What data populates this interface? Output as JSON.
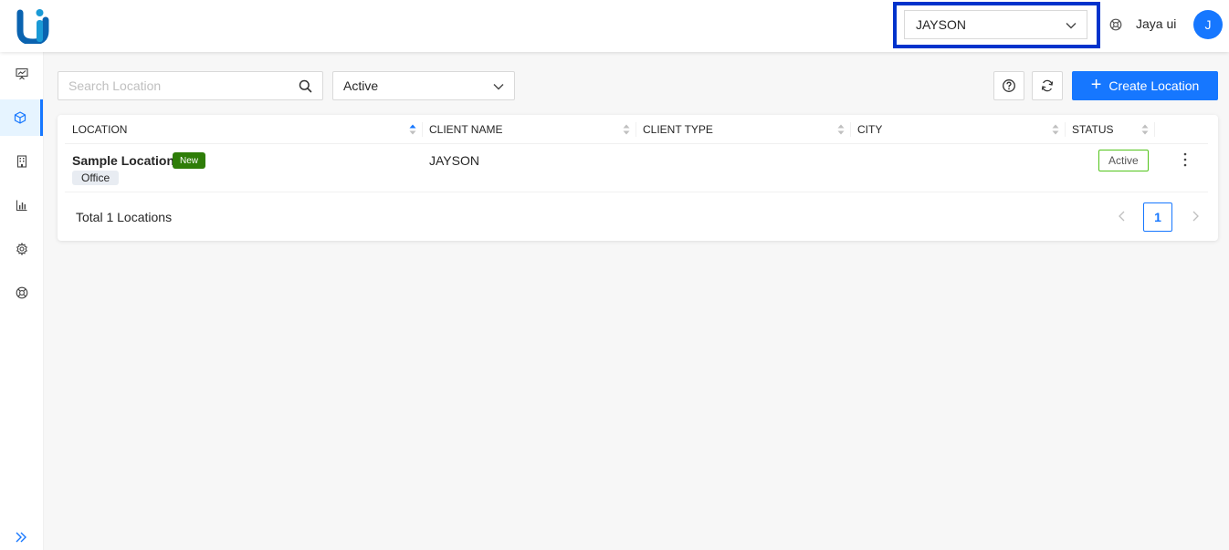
{
  "header": {
    "client_selected": "JAYSON",
    "user_name": "Jaya ui",
    "avatar_initial": "J"
  },
  "sidebar": {
    "items": [
      {
        "icon": "presentation-chart-icon"
      },
      {
        "icon": "cube-icon",
        "active": true
      },
      {
        "icon": "building-icon"
      },
      {
        "icon": "bar-chart-icon"
      },
      {
        "icon": "gear-icon"
      },
      {
        "icon": "support-icon"
      }
    ],
    "collapse_icon": "double-chevron-right-icon"
  },
  "toolbar": {
    "search_placeholder": "Search Location",
    "status_filter": "Active",
    "create_label": "Create Location"
  },
  "table": {
    "columns": [
      "LOCATION",
      "CLIENT NAME",
      "CLIENT TYPE",
      "CITY",
      "STATUS"
    ],
    "rows": [
      {
        "location": "Sample Location",
        "badge": "New",
        "type": "Office",
        "client_name": "JAYSON",
        "client_type": "",
        "city": "",
        "status": "Active"
      }
    ],
    "total_text": "Total 1 Locations",
    "current_page": "1"
  },
  "colors": {
    "primary": "#1677ff",
    "highlight_border": "#0033cc",
    "new_badge": "#2e7d08",
    "status_border": "#52c41a"
  }
}
